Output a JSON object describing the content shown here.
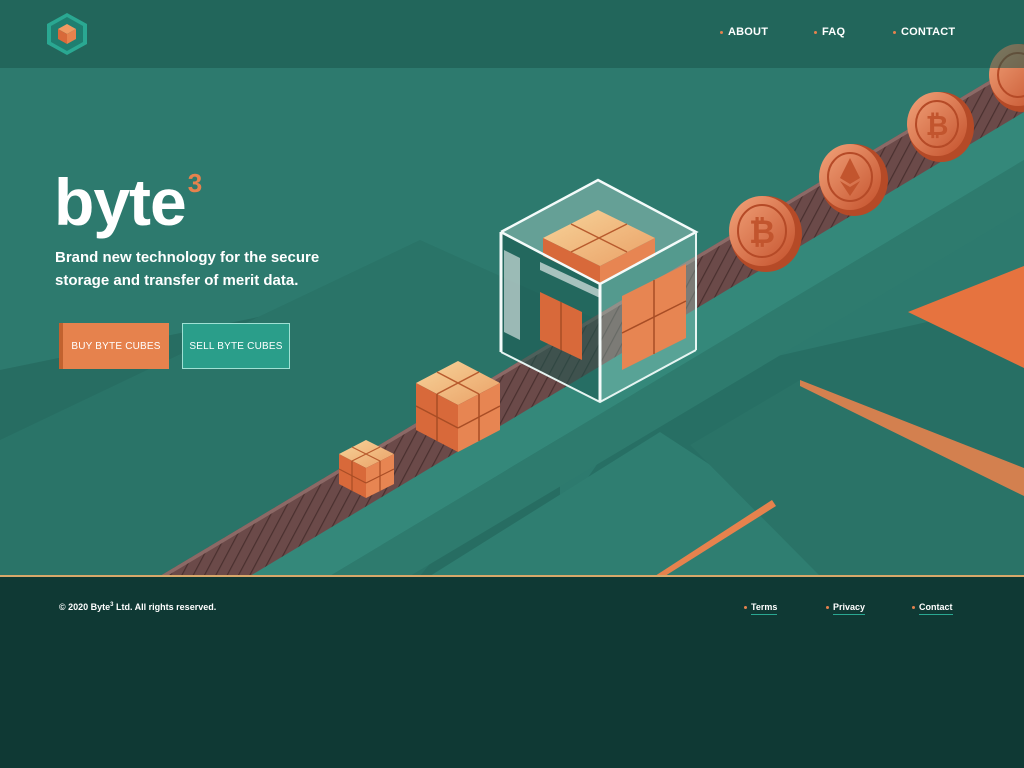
{
  "brand": {
    "name": "byte",
    "superscript": "3",
    "logo_icon": "cube-icon"
  },
  "nav": {
    "about": "ABOUT",
    "faq": "FAQ",
    "contact": "CONTACT"
  },
  "hero": {
    "tagline": "Brand new technology for the secure storage and transfer of merit data.",
    "buy_label": "BUY BYTE CUBES",
    "sell_label": "SELL BYTE CUBES"
  },
  "footer": {
    "copyright_prefix": "© 2020 Byte",
    "copyright_sup": "3",
    "copyright_suffix": " Ltd. All rights reserved.",
    "links": {
      "terms": "Terms",
      "privacy": "Privacy",
      "contact": "Contact"
    }
  },
  "colors": {
    "accent": "#e6824d",
    "teal": "#2d7a6e",
    "dark": "#0f3934",
    "sell_button": "#2a9e8a"
  }
}
